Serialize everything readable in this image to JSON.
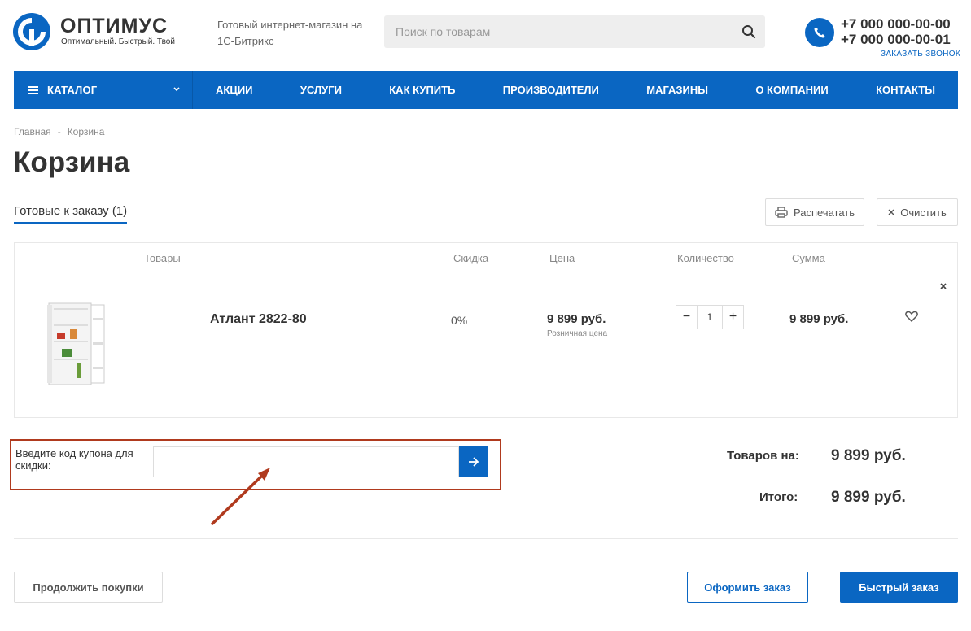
{
  "header": {
    "logo_title": "ОПТИМУС",
    "logo_sub": "Оптимальный. Быстрый. Твой",
    "slogan": "Готовый интернет-магазин на 1С-Битрикс",
    "search_placeholder": "Поиск по товарам",
    "phone1": "+7 000 000-00-00",
    "phone2": "+7 000 000-00-01",
    "callback": "ЗАКАЗАТЬ ЗВОНОК"
  },
  "nav": {
    "catalog": "КАТАЛОГ",
    "items": [
      "АКЦИИ",
      "УСЛУГИ",
      "КАК КУПИТЬ",
      "ПРОИЗВОДИТЕЛИ",
      "МАГАЗИНЫ",
      "О КОМПАНИИ",
      "КОНТАКТЫ"
    ]
  },
  "breadcrumb": [
    "Главная",
    "-",
    "Корзина"
  ],
  "page_title": "Корзина",
  "toolbar": {
    "tab_ready": "Готовые к заказу (1)",
    "print": "Распечатать",
    "clear": "Очистить"
  },
  "table": {
    "headers": [
      "Товары",
      "Скидка",
      "Цена",
      "Количество",
      "Сумма"
    ],
    "rows": [
      {
        "name": "Атлант 2822-80",
        "discount": "0%",
        "price": "9 899 руб.",
        "price_type": "Розничная цена",
        "qty": "1",
        "sum": "9 899 руб."
      }
    ]
  },
  "coupon": {
    "label": "Введите код купона для скидки:",
    "value": ""
  },
  "totals": {
    "goods_label": "Товаров на:",
    "goods_value": "9 899 руб.",
    "total_label": "Итого:",
    "total_value": "9 899 руб."
  },
  "buttons": {
    "continue": "Продолжить покупки",
    "checkout": "Оформить заказ",
    "quick": "Быстрый заказ"
  },
  "colors": {
    "accent": "#0a66c2",
    "annotation": "#b03a1e"
  }
}
